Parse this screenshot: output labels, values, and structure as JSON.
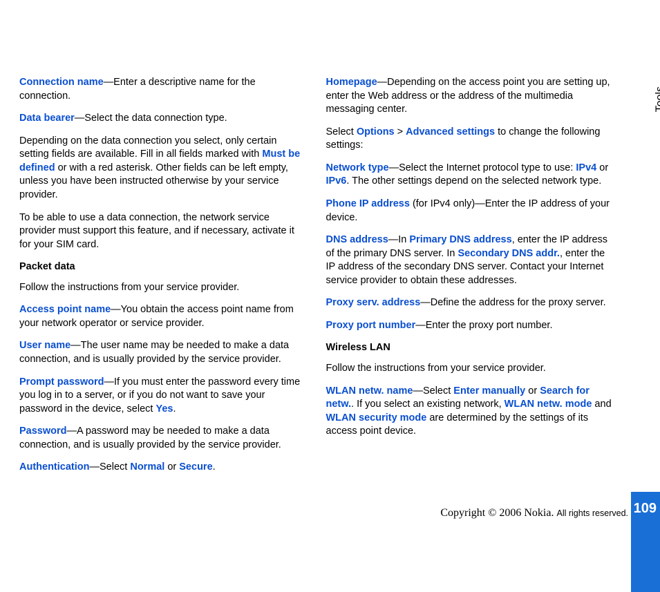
{
  "sidebar": {
    "label": "Tools",
    "page_number": "109"
  },
  "footer": {
    "copyright": "Copyright © 2006 Nokia. ",
    "rights": "All rights reserved."
  },
  "left": {
    "p1": {
      "term": "Connection name",
      "text": "—Enter a descriptive name for the connection."
    },
    "p2": {
      "term": "Data bearer",
      "text": "—Select the data connection type."
    },
    "p3a": "Depending on the data connection you select, only certain setting fields are available. Fill in all fields marked with ",
    "p3term": "Must be defined",
    "p3b": " or with a red asterisk. Other fields can be left empty, unless you have been instructed otherwise by your service provider.",
    "p4": "To be able to use a data connection, the network service provider must support this feature, and if necessary, activate it for your SIM card.",
    "h1": "Packet data",
    "p5": "Follow the instructions from your service provider.",
    "p6": {
      "term": "Access point name",
      "text": "—You obtain the access point name from your network operator or service provider."
    },
    "p7": {
      "term": "User name",
      "text": "—The user name may be needed to make a data connection, and is usually provided by the service provider."
    },
    "p8a": {
      "term": "Prompt password",
      "text": "—If you must enter the password every time you log in to a server, or if you do not want to save your password in the device, select "
    },
    "p8yes": "Yes",
    "p8b": ".",
    "p9": {
      "term": "Password",
      "text": "—A password may be needed to make a data connection, and is usually provided by the service provider."
    },
    "p10a": {
      "term": "Authentication",
      "text": "—Select "
    },
    "p10n": "Normal",
    "p10or": " or ",
    "p10s": "Secure",
    "p10b": "."
  },
  "right": {
    "p1": {
      "term": "Homepage",
      "text": "—Depending on the access point you are setting up, enter the Web address or the address of the multimedia messaging center."
    },
    "p2a": "Select ",
    "p2opt": "Options",
    "p2gt": " > ",
    "p2adv": "Advanced settings",
    "p2b": " to change the following settings:",
    "p3a": {
      "term": "Network type",
      "text": "—Select the Internet protocol type to use: "
    },
    "p3v4": "IPv4",
    "p3or": " or ",
    "p3v6": "IPv6",
    "p3b": ". The other settings depend on the selected network type.",
    "p4": {
      "term": "Phone IP address",
      "text": " (for IPv4 only)—Enter the IP address of your device."
    },
    "p5a": {
      "term": "DNS address",
      "text": "—In "
    },
    "p5p": "Primary DNS address",
    "p5b": ", enter the IP address of the primary DNS server. In ",
    "p5s": "Secondary DNS addr.",
    "p5c": ", enter the IP address of the secondary DNS server. Contact your Internet service provider to obtain these addresses.",
    "p6": {
      "term": "Proxy serv. address",
      "text": "—Define the address for the proxy server."
    },
    "p7": {
      "term": "Proxy port number",
      "text": "—Enter the proxy port number."
    },
    "h1": "Wireless LAN",
    "p8": "Follow the instructions from your service provider.",
    "p9a": {
      "term": "WLAN netw. name",
      "text": "—Select "
    },
    "p9em": "Enter manually",
    "p9or": " or ",
    "p9sf": "Search for netw.",
    "p9b": ". If you select an existing network, ",
    "p9wm": "WLAN netw. mode",
    "p9and": " and ",
    "p9ws": "WLAN security mode",
    "p9c": " are determined by the settings of its access point device."
  }
}
